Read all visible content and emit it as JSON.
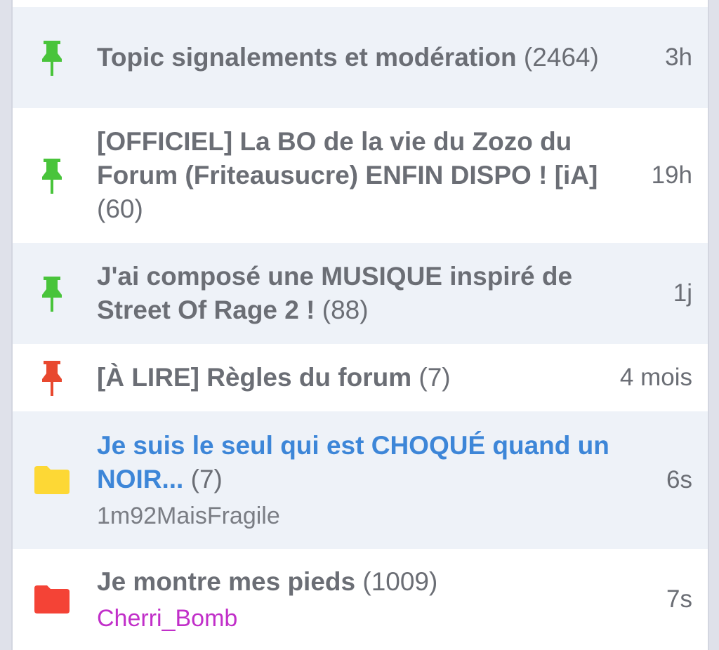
{
  "topics": [
    {
      "title": "Topic signalements et modération",
      "count": "(2464)",
      "time": "3h",
      "icon": "pin-green-icon"
    },
    {
      "title": "[OFFICIEL] La BO de la vie du Zozo du Forum (Friteausucre) ENFIN DISPO ! [iA]",
      "count": "(60)",
      "time": "19h",
      "icon": "pin-green-icon"
    },
    {
      "title": "J'ai composé une MUSIQUE inspiré de Street Of Rage 2 !",
      "count": "(88)",
      "time": "1j",
      "icon": "pin-green-icon"
    },
    {
      "title": "[À LIRE] Règles du forum",
      "count": "(7)",
      "time": "4 mois",
      "icon": "pin-red-icon"
    },
    {
      "title": "Je suis le seul qui est CHOQUÉ quand un NOIR...",
      "count": "(7)",
      "time": "6s",
      "author": "1m92MaisFragile",
      "icon": "folder-yellow-icon"
    },
    {
      "title": "Je montre mes pieds",
      "count": "(1009)",
      "time": "7s",
      "author": "Cherri_Bomb",
      "icon": "folder-red-icon"
    }
  ],
  "colors": {
    "pin_green": "#49c43b",
    "pin_red": "#e8482f",
    "folder_yellow": "#fdd835",
    "folder_red": "#f44336",
    "link_blue": "#3d86d8",
    "author_purple": "#c12fc9"
  }
}
